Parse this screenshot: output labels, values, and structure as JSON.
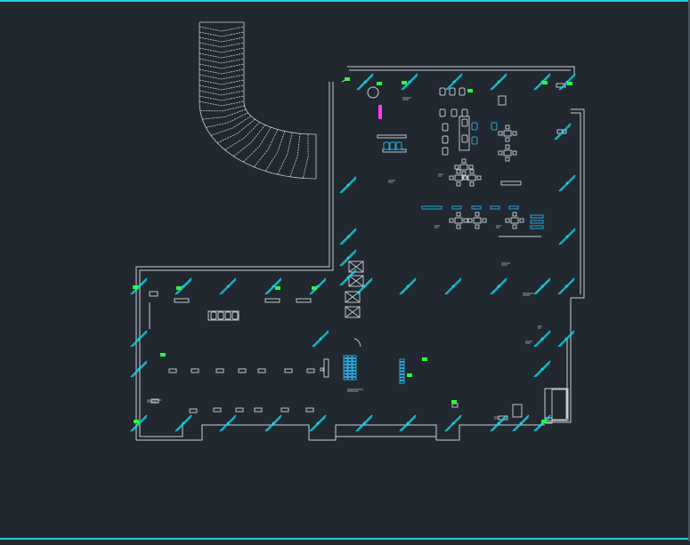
{
  "drawing": {
    "background": "#212830",
    "colors": {
      "wall": "#c9ced4",
      "furniture": "#bfc5cb",
      "light_fixture": "#19d7e8",
      "sensor": "#2bff3a",
      "highlight": "#ff3cff",
      "seat_blue": "#2aa7d8",
      "frame": "#1fd0d8"
    },
    "icons": [
      "stair-icon",
      "light-fixture-icon",
      "sensor-icon",
      "chair-icon",
      "cabinet-icon"
    ]
  }
}
